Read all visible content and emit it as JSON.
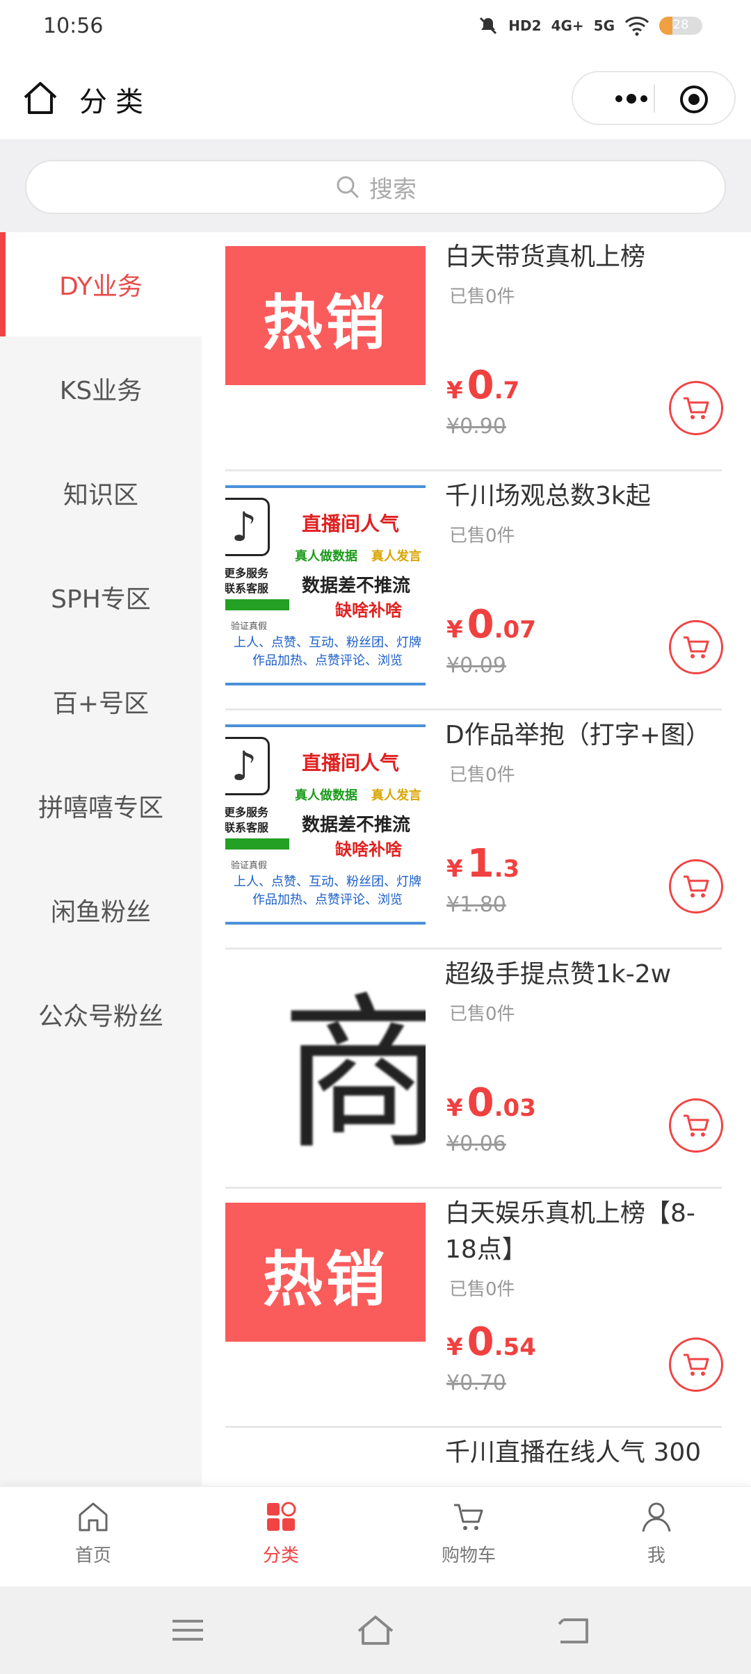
{
  "status_bar": {
    "time": "10:56",
    "hd": "HD2",
    "net1": "4G+",
    "net2": "5G",
    "battery": "28"
  },
  "nav": {
    "title": "分类"
  },
  "search": {
    "placeholder": "搜索"
  },
  "sidebar": {
    "items": [
      {
        "label": "DY业务",
        "active": true
      },
      {
        "label": "KS业务"
      },
      {
        "label": "知识区"
      },
      {
        "label": "SPH专区"
      },
      {
        "label": "百+号区"
      },
      {
        "label": "拼嘻嘻专区"
      },
      {
        "label": "闲鱼粉丝"
      },
      {
        "label": "公众号粉丝"
      }
    ]
  },
  "products": [
    {
      "name": "白天带货真机上榜",
      "sold": "已售0件",
      "currency": "¥",
      "price_int": "0",
      "price_dec": ".7",
      "orig": "¥0.90",
      "thumb": "hot"
    },
    {
      "name": "千川场观总数3k起",
      "sold": "已售0件",
      "currency": "¥",
      "price_int": "0",
      "price_dec": ".07",
      "orig": "¥0.09",
      "thumb": "poster"
    },
    {
      "name": "D作品举抱（打字+图）",
      "sold": "已售0件",
      "currency": "¥",
      "price_int": "1",
      "price_dec": ".3",
      "orig": "¥1.80",
      "thumb": "poster"
    },
    {
      "name": "超级手提点赞1k-2w",
      "sold": "已售0件",
      "currency": "¥",
      "price_int": "0",
      "price_dec": ".03",
      "orig": "¥0.06",
      "thumb": "pixel"
    },
    {
      "name": "白天娱乐真机上榜【8-18点】",
      "sold": "已售0件",
      "currency": "¥",
      "price_int": "0",
      "price_dec": ".54",
      "orig": "¥0.70",
      "thumb": "hot"
    },
    {
      "name": "千川直播在线人气 300"
    }
  ],
  "thumbs": {
    "hot_label": "热销",
    "poster": {
      "title": "直播间人气",
      "tag1": "真人做数据",
      "tag2": "真人发言",
      "line1": "数据差不推流",
      "line2": "缺啥补啥",
      "side": "更多服务\n联系客服",
      "verify": "验证真假",
      "footer": "上人、点赞、互动、粉丝团、灯牌\n作品加热、点赞评论、浏览"
    },
    "pixel_glyph": "商"
  },
  "tabs": [
    {
      "label": "首页",
      "icon": "home-icon"
    },
    {
      "label": "分类",
      "icon": "category-icon",
      "active": true
    },
    {
      "label": "购物车",
      "icon": "cart-icon"
    },
    {
      "label": "我",
      "icon": "user-icon"
    }
  ],
  "colors": {
    "accent": "#f04444",
    "hot_banner": "#fa5c5c"
  }
}
